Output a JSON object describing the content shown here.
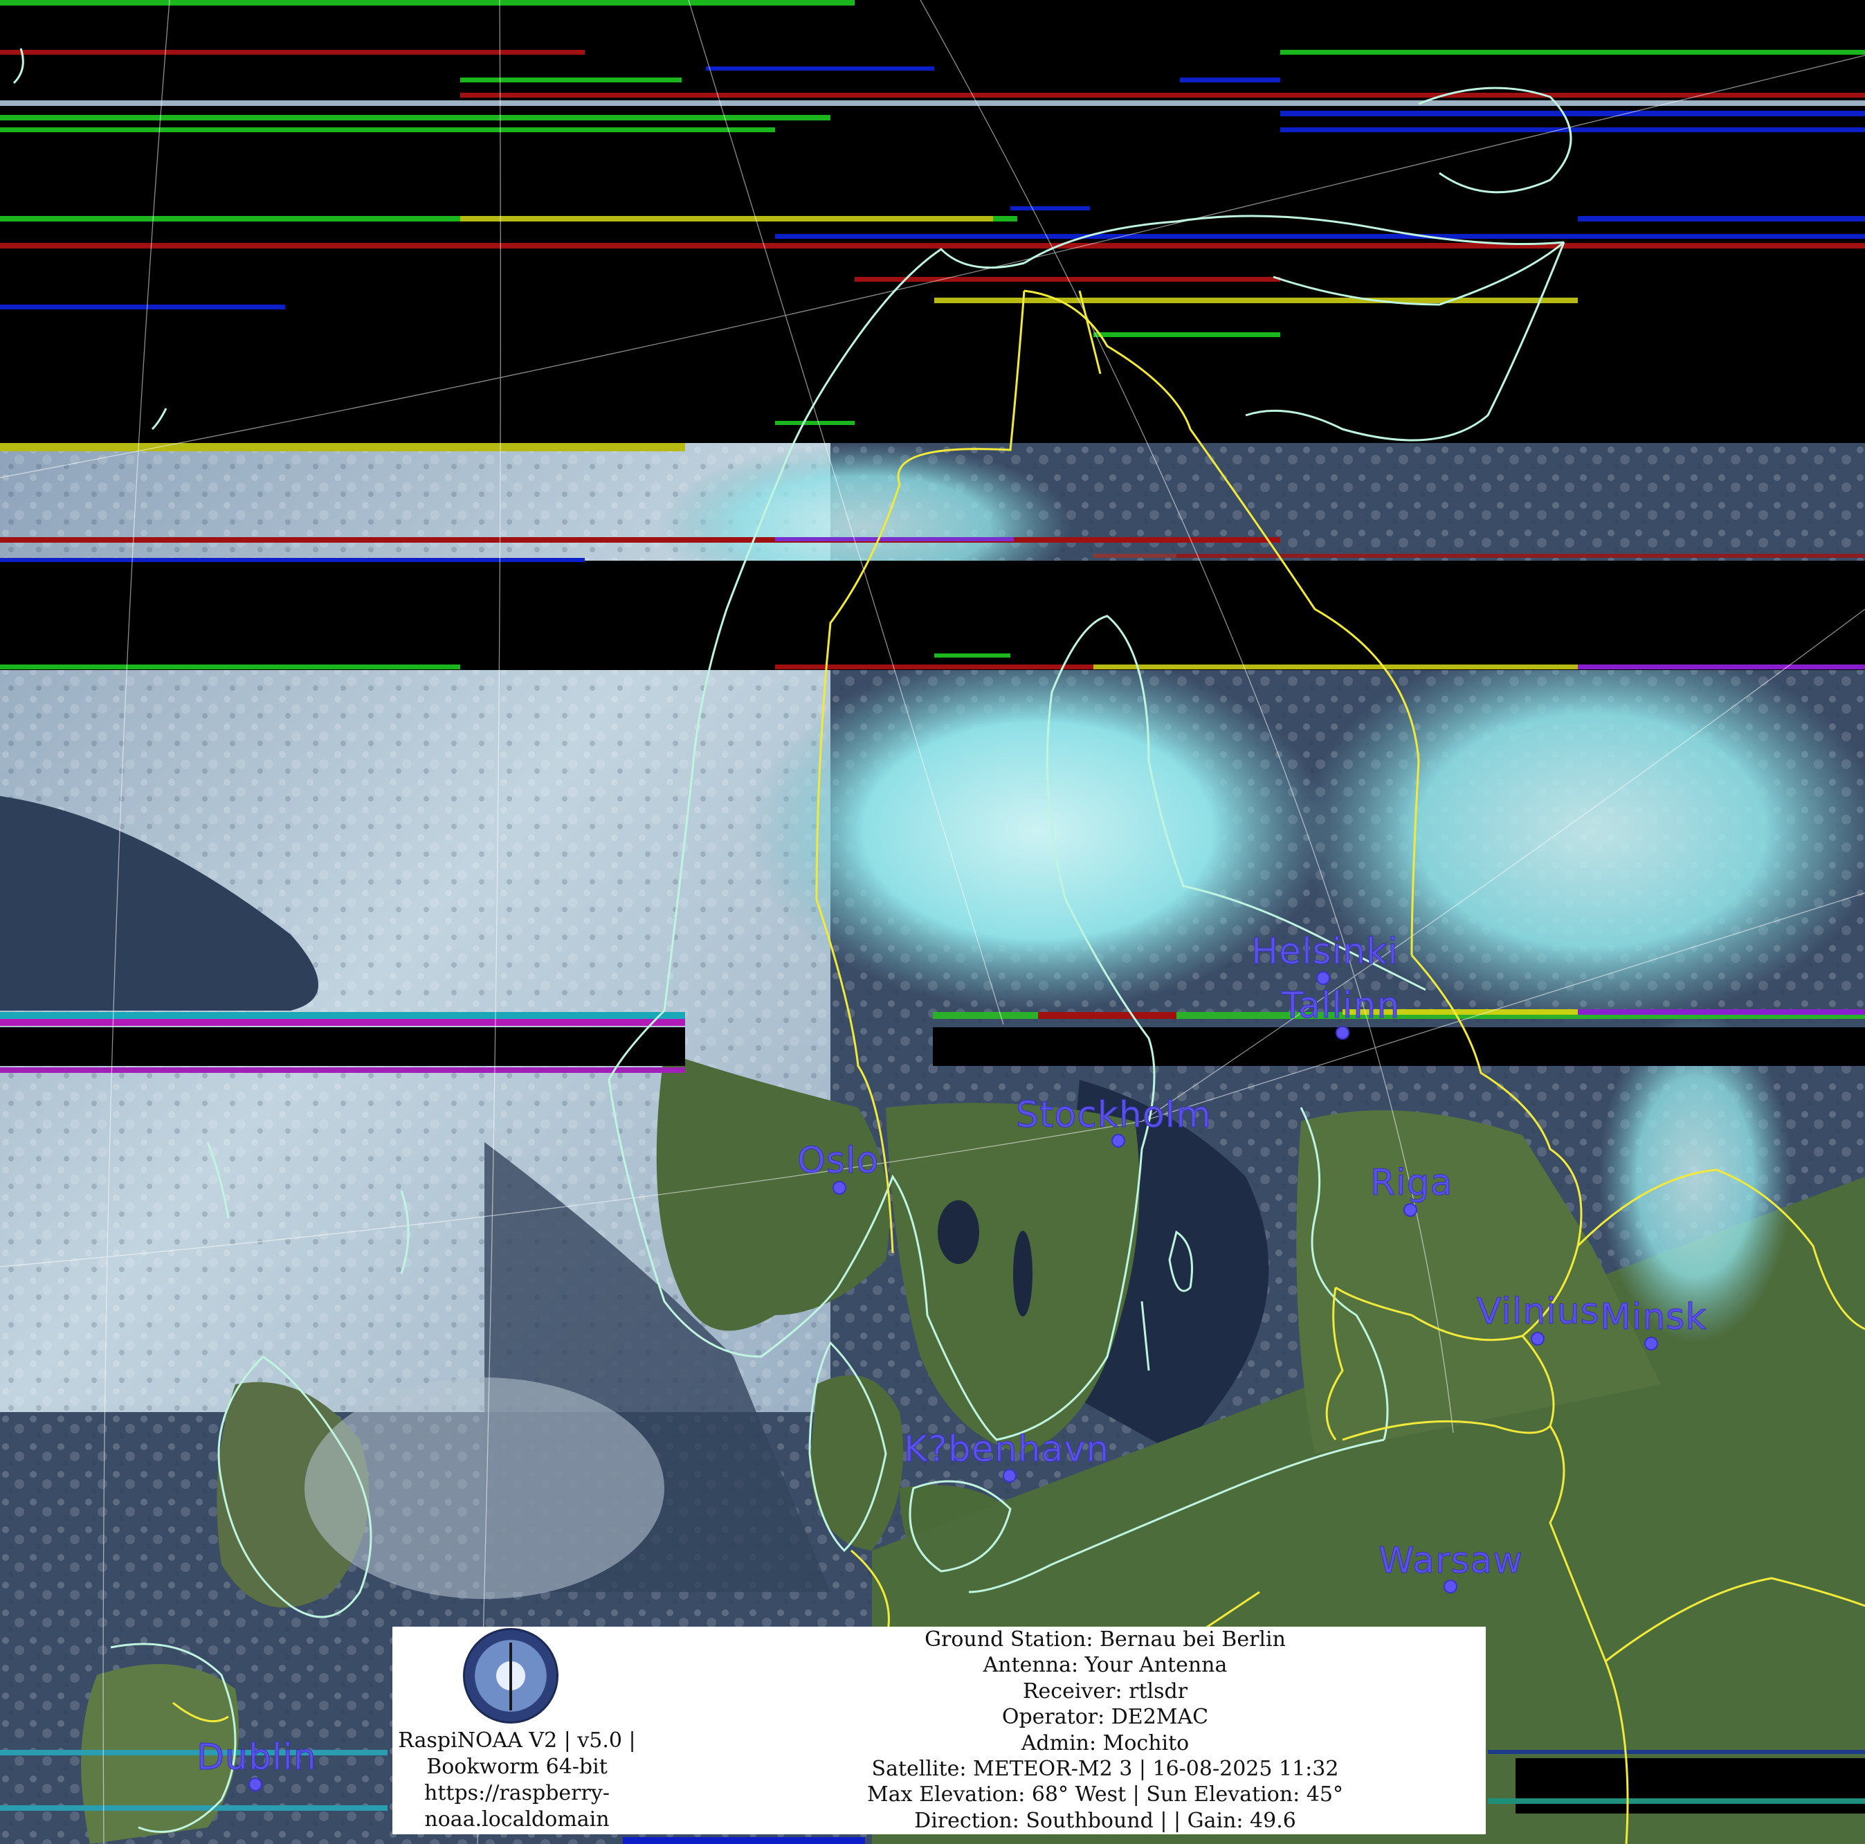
{
  "cities": [
    {
      "name": "Helsinki",
      "dot": [
        1912,
        1413
      ],
      "label": [
        1808,
        1392
      ]
    },
    {
      "name": "Tallinn",
      "dot": [
        1940,
        1492
      ],
      "label": [
        1852,
        1470
      ]
    },
    {
      "name": "Stockholm",
      "dot": [
        1616,
        1648
      ],
      "label": [
        1468,
        1628
      ]
    },
    {
      "name": "Oslo",
      "dot": [
        1213,
        1716
      ],
      "label": [
        1152,
        1694
      ]
    },
    {
      "name": "Riga",
      "dot": [
        2038,
        1748
      ],
      "label": [
        1980,
        1726
      ]
    },
    {
      "name": "Vilnius",
      "dot": [
        2222,
        1934
      ],
      "label": [
        2134,
        1912
      ]
    },
    {
      "name": "Minsk",
      "dot": [
        2386,
        1941
      ],
      "label": [
        2312,
        1920
      ]
    },
    {
      "name": "K?benhavn",
      "dot": [
        1459,
        2132
      ],
      "label": [
        1306,
        2111
      ]
    },
    {
      "name": "Warsaw",
      "dot": [
        2096,
        2292
      ],
      "label": [
        1992,
        2272
      ]
    },
    {
      "name": "Dublin",
      "dot": [
        369,
        2578
      ],
      "label": [
        284,
        2556
      ]
    }
  ],
  "station": {
    "line1": "RaspiNOAA V2 | v5.0 |",
    "line2": "Bookworm 64-bit",
    "line3": "https://raspberry-",
    "line4": "noaa.localdomain"
  },
  "pass_info": {
    "ground_station": "Ground Station: Bernau bei Berlin",
    "antenna": "Antenna: Your Antenna",
    "receiver": "Receiver: rtlsdr",
    "operator": "Operator: DE2MAC",
    "admin": "Admin: Mochito",
    "satellite": "Satellite: METEOR-M2 3 | 16-08-2025 11:32",
    "elevation": "Max Elevation: 68° West | Sun Elevation: 45°",
    "direction": "Direction: Southbound | | Gain: 49.6"
  },
  "colors": {
    "border_yellow": "#f2ea3a",
    "coast": "#bff5e0",
    "city": "#5a52e6"
  },
  "icons": {
    "logo": "raspinoaa-badge-icon"
  }
}
